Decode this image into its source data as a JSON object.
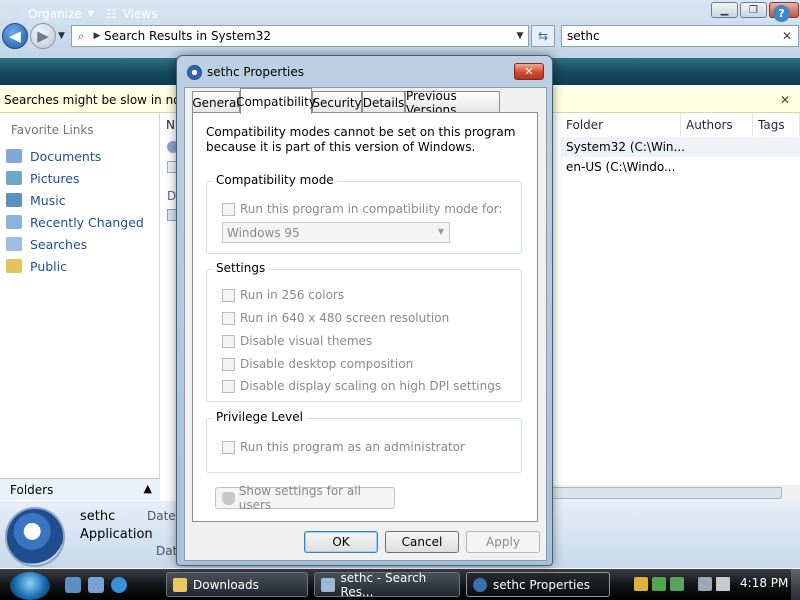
{
  "explorer": {
    "address_path": "Search Results in System32",
    "search_value": "sethc",
    "organize_label": "Organize",
    "views_label": "Views",
    "info_bar_text": "Searches might be slow in non-ir",
    "favorite_links_title": "Favorite Links",
    "favorite_links": [
      "Documents",
      "Pictures",
      "Music",
      "Recently Changed",
      "Searches",
      "Public"
    ],
    "folders_label": "Folders",
    "columns": {
      "name_partial": "N",
      "folder": "Folder",
      "authors": "Authors",
      "tags": "Tags"
    },
    "rows": [
      {
        "folder": "System32 (C:\\Win..."
      },
      {
        "folder": "en-US (C:\\Windo..."
      }
    ],
    "group_header_partial": "D",
    "details": {
      "name": "sethc",
      "type": "Application",
      "date_label": "Date",
      "date_label_2": "Date"
    }
  },
  "dialog": {
    "title": "sethc Properties",
    "tabs": [
      "General",
      "Compatibility",
      "Security",
      "Details",
      "Previous Versions"
    ],
    "active_tab": "Compatibility",
    "notice": "Compatibility modes cannot be set on this program because it is part of this version of Windows.",
    "compat_group": {
      "label": "Compatibility mode",
      "checkbox": "Run this program in compatibility mode for:",
      "select_value": "Windows 95"
    },
    "settings_group": {
      "label": "Settings",
      "checkboxes": [
        "Run in 256 colors",
        "Run in 640 x 480 screen resolution",
        "Disable visual themes",
        "Disable desktop composition",
        "Disable display scaling on high DPI settings"
      ]
    },
    "privilege_group": {
      "label": "Privilege Level",
      "checkbox": "Run this program as an administrator"
    },
    "all_users_button": "Show settings for all users",
    "ok_label": "OK",
    "cancel_label": "Cancel",
    "apply_label": "Apply"
  },
  "taskbar": {
    "tasks": [
      "Downloads",
      "sethc - Search Res...",
      "sethc Properties"
    ],
    "clock": "4:18 PM"
  }
}
